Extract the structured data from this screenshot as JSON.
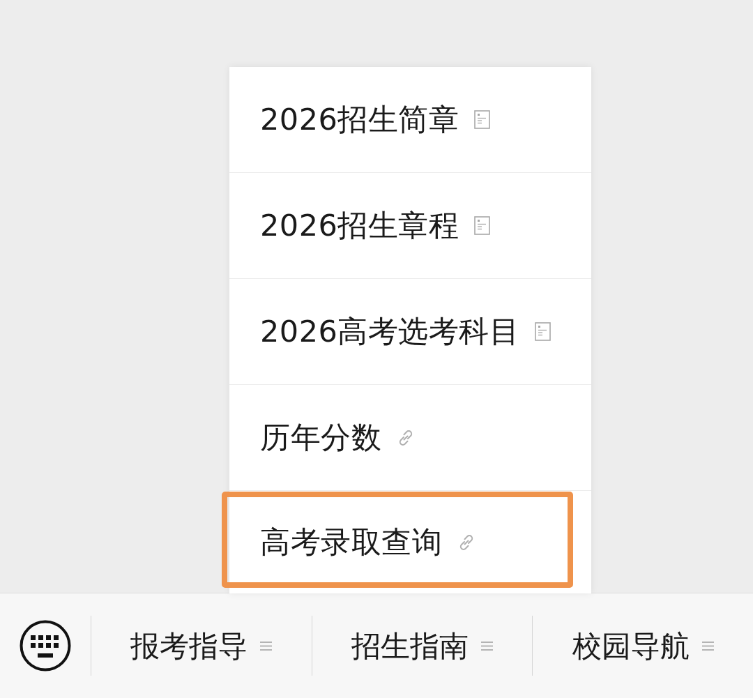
{
  "menu": {
    "items": [
      {
        "label": "2026招生简章",
        "kind": "article",
        "highlighted": false
      },
      {
        "label": "2026招生章程",
        "kind": "article",
        "highlighted": false
      },
      {
        "label": "2026高考选考科目",
        "kind": "article",
        "highlighted": false
      },
      {
        "label": "历年分数",
        "kind": "link",
        "highlighted": false
      },
      {
        "label": "高考录取查询",
        "kind": "link",
        "highlighted": true
      }
    ]
  },
  "bottom_bar": {
    "tabs": [
      {
        "label": "报考指导"
      },
      {
        "label": "招生指南"
      },
      {
        "label": "校园导航"
      }
    ]
  }
}
